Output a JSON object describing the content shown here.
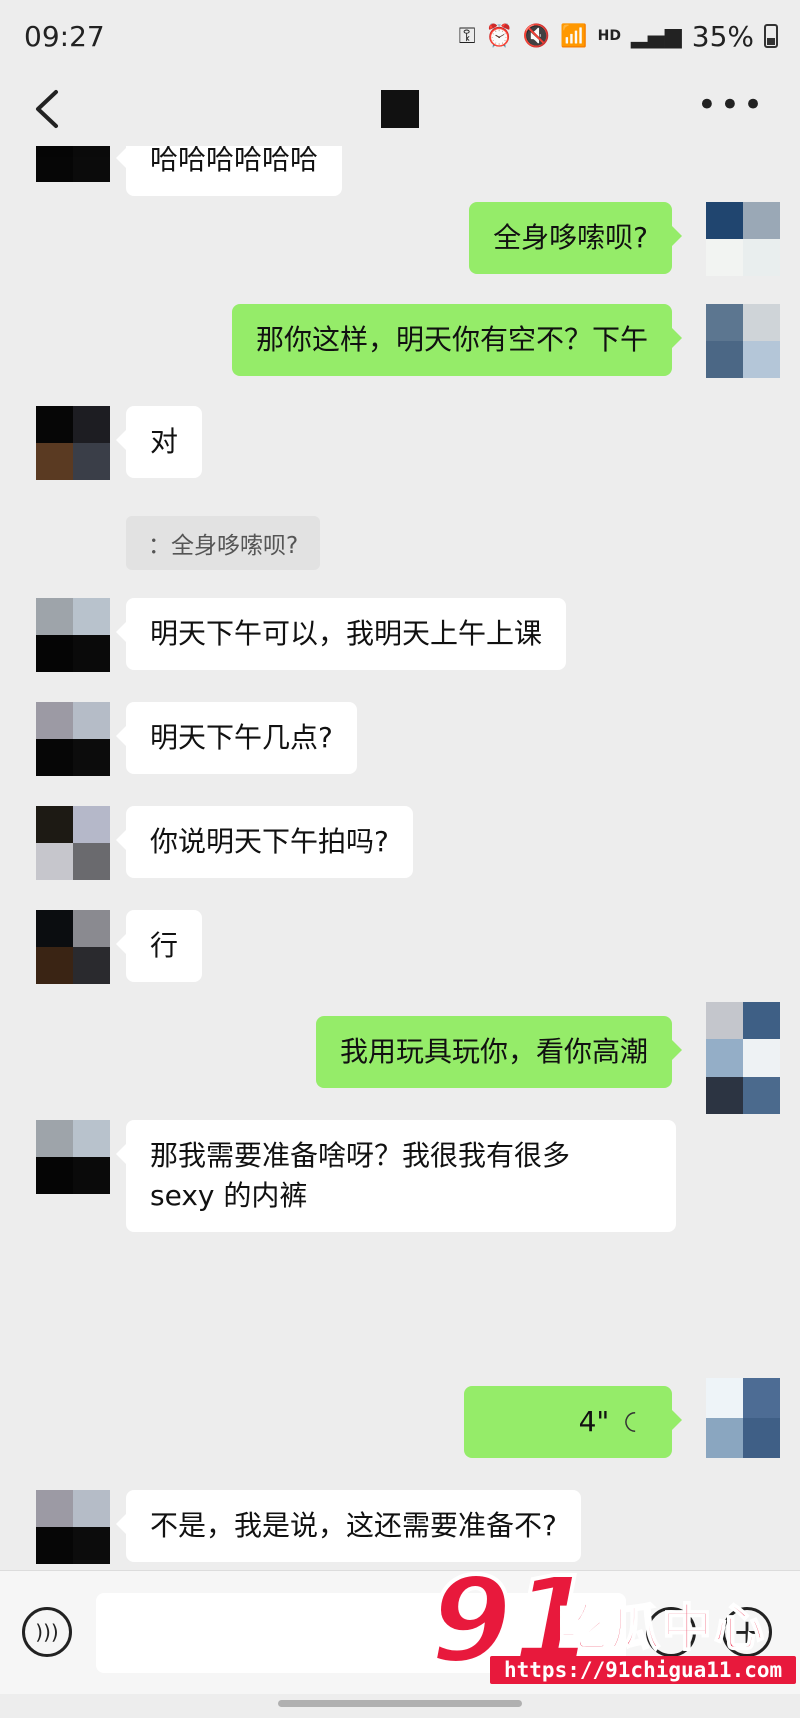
{
  "status_bar": {
    "time": "09:27",
    "hd": "HD",
    "battery": "35%"
  },
  "title_bar": {
    "contact_name": ""
  },
  "colors": {
    "outgoing_bubble": "#95ec69",
    "incoming_bubble": "#ffffff",
    "background": "#ededed",
    "watermark": "#e8193c"
  },
  "messages": [
    {
      "side": "in",
      "text": "哈哈哈哈哈哈"
    },
    {
      "side": "out",
      "text": "全身哆嗦呗?"
    },
    {
      "side": "out",
      "text": "那你这样，明天你有空不？下午"
    },
    {
      "side": "in",
      "text": "对"
    },
    {
      "type": "quote",
      "text": "：全身哆嗦呗?"
    },
    {
      "side": "in",
      "text": "明天下午可以，我明天上午上课"
    },
    {
      "side": "in",
      "text": "明天下午几点?"
    },
    {
      "side": "in",
      "text": "你说明天下午拍吗?"
    },
    {
      "side": "in",
      "text": "行"
    },
    {
      "side": "out",
      "text": "我用玩具玩你，看你高潮"
    },
    {
      "side": "in",
      "text_line1": "那我需要准备啥呀？我很我有很多",
      "text_line2": "sexy 的内裤"
    },
    {
      "side": "out",
      "type": "voice",
      "duration": "4\""
    },
    {
      "side": "in",
      "text": "不是，我是说，这还需要准备不?"
    }
  ],
  "input_bar": {
    "voice_icon": "voice-icon",
    "emoji_icon": "emoji-icon",
    "plus_icon": "plus-icon"
  },
  "watermark": {
    "big": "91",
    "brand": "吃瓜中心",
    "url": "https://91chigua11.com"
  }
}
